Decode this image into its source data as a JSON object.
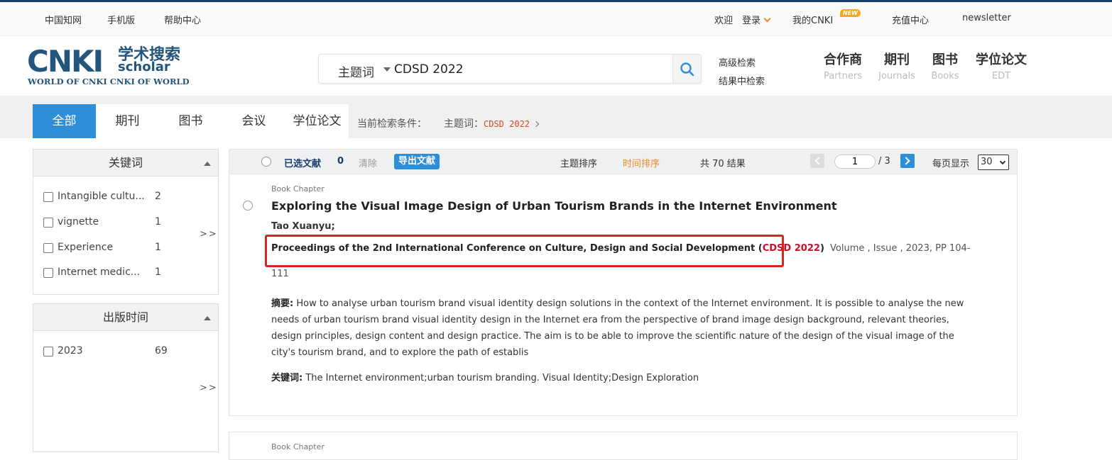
{
  "topbar": {
    "links": [
      "中国知网",
      "手机版",
      "帮助中心"
    ],
    "welcome": "欢迎",
    "login": "登录",
    "my_cnki": "我的CNKI",
    "new_badge": "NEW",
    "recharge": "充值中心",
    "newsletter": "newsletter"
  },
  "logo": {
    "main": "CNKI",
    "cn": "学术搜索",
    "scholar": "scholar",
    "sub": "WORLD OF CNKI CNKI OF WORLD"
  },
  "search": {
    "field": "主题词",
    "value": "CDSD 2022",
    "advanced": "高级检索",
    "within": "结果中检索"
  },
  "nav": [
    {
      "cn": "合作商",
      "en": "Partners"
    },
    {
      "cn": "期刊",
      "en": "Journals"
    },
    {
      "cn": "图书",
      "en": "Books"
    },
    {
      "cn": "学位论文",
      "en": "EDT"
    }
  ],
  "tabs": [
    "全部",
    "期刊",
    "图书",
    "会议",
    "学位论文"
  ],
  "condition": {
    "label": "当前检索条件：",
    "field": "主题词：",
    "value": "CDSD 2022"
  },
  "facets": {
    "keywords": {
      "title": "关键词",
      "items": [
        {
          "label": "Intangible cultu...",
          "count": "2"
        },
        {
          "label": "vignette",
          "count": "1"
        },
        {
          "label": "Experience",
          "count": "1"
        },
        {
          "label": "Internet medic...",
          "count": "1"
        }
      ],
      "more": ">>"
    },
    "pubtime": {
      "title": "出版时间",
      "items": [
        {
          "label": "2023",
          "count": "69"
        }
      ],
      "more": ">>"
    }
  },
  "toolbar": {
    "selected_label": "已选文献",
    "selected_count": "0",
    "clear": "清除",
    "export": "导出文献",
    "sort_topic": "主题排序",
    "sort_time": "时间排序",
    "total": "共 70 结果",
    "page": "1",
    "page_total": "/ 3",
    "per_page_label": "每页显示",
    "per_page": "30"
  },
  "result": {
    "type": "Book Chapter",
    "title": "Exploring the Visual Image Design of Urban Tourism Brands in the Internet Environment",
    "author": "Tao Xuanyu;",
    "source_prefix": "Proceedings of the 2nd International Conference on Culture, Design and Social Development (",
    "source_highlight": "CDSD 2022",
    "source_suffix": ")",
    "volume": "Volume , Issue , 2023, PP 104-",
    "volume_cont": "111",
    "abstract_label": "摘要:",
    "abstract": " How to analyse urban tourism brand visual identity design solutions in the context of the Internet environment. It is possible to analyse the new needs of urban tourism brand visual identity design in the Internet era from the perspective of brand image design background, relevant theories, design principles, design content and design practice. The aim is to be able to improve the scientific nature of the design of the visual image of the city's tourism brand, and to explore the path of establis",
    "keywords_label": "关键词:",
    "keywords": " The Internet environment;urban tourism branding. Visual Identity;Design Exploration"
  },
  "result2": {
    "type": "Book Chapter"
  },
  "colors": {
    "accent": "#2e8fd8",
    "highlight_red": "#d8261f",
    "sort_active": "#f08a24"
  }
}
